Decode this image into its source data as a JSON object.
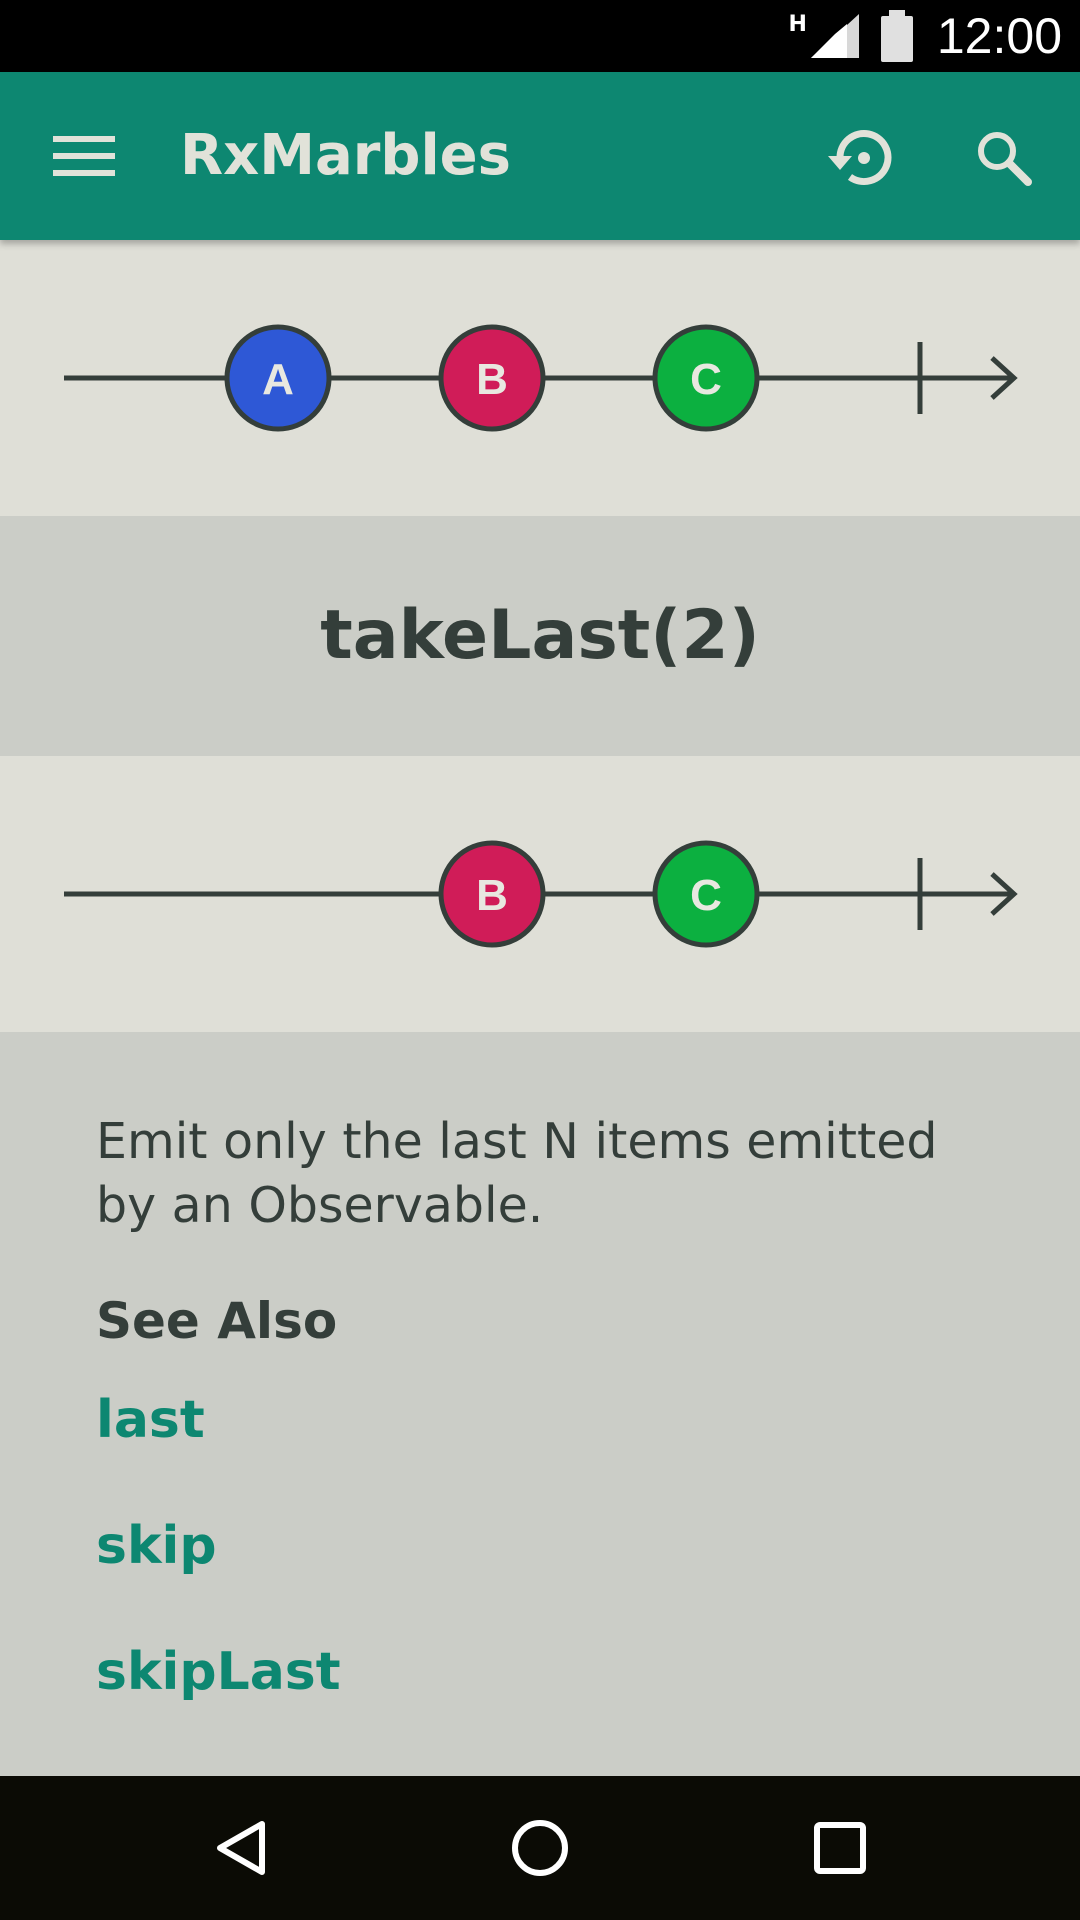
{
  "status_bar": {
    "network_type": "H",
    "time": "12:00"
  },
  "app_bar": {
    "title": "RxMarbles",
    "menu_icon": "menu-icon",
    "history_icon": "history-icon",
    "search_icon": "search-icon",
    "background_color": "#0d8771",
    "title_color": "#e1e2d9"
  },
  "input_stream": {
    "marbles": [
      {
        "label": "A",
        "color": "#2e58d6"
      },
      {
        "label": "B",
        "color": "#d01c58"
      },
      {
        "label": "C",
        "color": "#0cb040"
      }
    ]
  },
  "operator": {
    "title": "takeLast(2)"
  },
  "output_stream": {
    "marbles": [
      {
        "label": "B",
        "color": "#d01c58"
      },
      {
        "label": "C",
        "color": "#0cb040"
      }
    ]
  },
  "description": {
    "text": "Emit only the last N items emitted by an Observable.",
    "see_also_heading": "See Also",
    "links": [
      {
        "label": "last"
      },
      {
        "label": "skip"
      },
      {
        "label": "skipLast"
      }
    ],
    "link_color": "#0d8771"
  },
  "nav_bar": {
    "back_icon": "back-icon",
    "home_icon": "home-icon",
    "recents_icon": "recents-icon"
  }
}
